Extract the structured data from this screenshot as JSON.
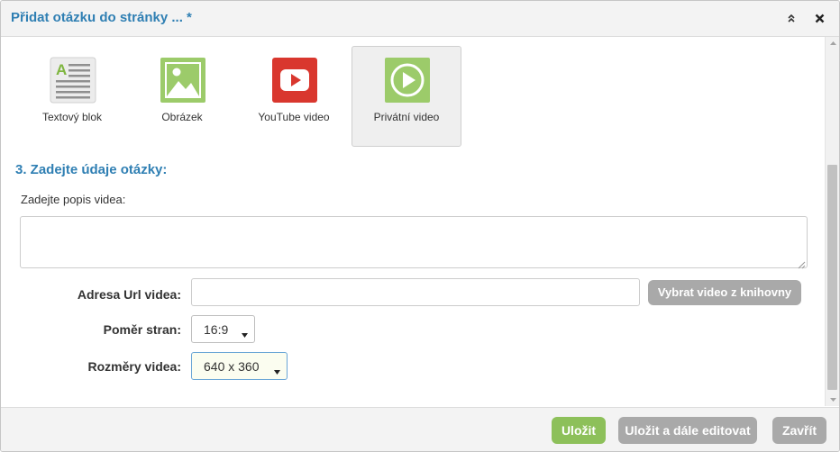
{
  "dialog": {
    "title": "Přidat otázku do stránky ... *",
    "collapse_icon": "double-chevron-up-icon",
    "close_icon": "close-icon"
  },
  "question_types": [
    {
      "label": "Textový blok",
      "icon": "text-block-icon",
      "color": "#e9e9e9",
      "selected": false
    },
    {
      "label": "Obrázek",
      "icon": "image-icon",
      "color": "#9ccb6a",
      "selected": false
    },
    {
      "label": "YouTube video",
      "icon": "youtube-icon",
      "color": "#d9372e",
      "selected": false
    },
    {
      "label": "Privátní video",
      "icon": "play-circle-icon",
      "color": "#9ccb6a",
      "selected": true
    }
  ],
  "section": {
    "heading": "3. Zadejte údaje otázky:",
    "description_label": "Zadejte popis videa:",
    "description_value": ""
  },
  "fields": {
    "url_label": "Adresa Url videa:",
    "url_value": "",
    "library_button": "Vybrat video z knihovny",
    "ratio_label": "Poměr stran:",
    "ratio_value": "16:9",
    "size_label": "Rozměry videa:",
    "size_value": "640 x 360"
  },
  "footer": {
    "save": "Uložit",
    "save_continue": "Uložit a dále editovat",
    "close": "Zavřít"
  },
  "colors": {
    "title": "#2f7fb3",
    "save_button": "#8dc05a",
    "secondary_button": "#a9a9a9"
  }
}
